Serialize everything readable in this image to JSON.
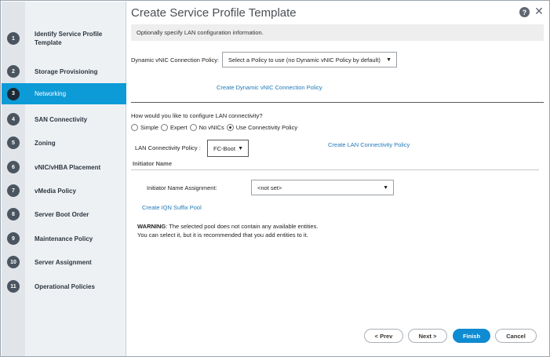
{
  "dialog": {
    "title": "Create Service Profile Template",
    "help_glyph": "?",
    "close_glyph": "✕",
    "info": "Optionally specify LAN configuration information."
  },
  "sidebar": {
    "steps": [
      {
        "num": "1",
        "label": "Identify Service Profile Template"
      },
      {
        "num": "2",
        "label": "Storage Provisioning"
      },
      {
        "num": "3",
        "label": "Networking"
      },
      {
        "num": "4",
        "label": "SAN Connectivity"
      },
      {
        "num": "5",
        "label": "Zoning"
      },
      {
        "num": "6",
        "label": "vNIC/vHBA Placement"
      },
      {
        "num": "7",
        "label": "vMedia Policy"
      },
      {
        "num": "8",
        "label": "Server Boot Order"
      },
      {
        "num": "9",
        "label": "Maintenance Policy"
      },
      {
        "num": "10",
        "label": "Server Assignment"
      },
      {
        "num": "11",
        "label": "Operational Policies"
      }
    ],
    "active_step": "3"
  },
  "networking": {
    "dynamic_vnic_label": "Dynamic vNIC Connection Policy:",
    "dynamic_vnic_value": "Select a Policy to use (no Dynamic vNIC Policy by default)",
    "create_dynamic_vnic_link": "Create Dynamic vNIC Connection Policy",
    "lan_question": "How would you like to configure LAN connectivity?",
    "radio_options": [
      {
        "label": "Simple",
        "selected": false
      },
      {
        "label": "Expert",
        "selected": false
      },
      {
        "label": "No vNICs",
        "selected": false
      },
      {
        "label": "Use Connectivity Policy",
        "selected": true
      }
    ],
    "lan_policy_label": "LAN Connectivity Policy :",
    "lan_policy_value": "FC-Boot",
    "create_lan_policy_link": "Create LAN Connectivity Policy",
    "initiator_section": "Initiator Name",
    "initiator_assignment_label": "Initiator Name Assignment:",
    "initiator_assignment_value": "<not set>",
    "create_iqn_link": "Create IQN Suffix Pool",
    "warning_label": "WARNING",
    "warning_line1": ": The selected pool does not contain any available entities.",
    "warning_line2": "You can select it, but it is recommended that you add entities to it.",
    "caret": "▼"
  },
  "footer": {
    "prev": "< Prev",
    "next": "Next >",
    "finish": "Finish",
    "cancel": "Cancel"
  },
  "colors": {
    "active_step_bg": "#0d9bd7",
    "link": "#1f79b8",
    "primary_button": "#0f8bd1"
  }
}
